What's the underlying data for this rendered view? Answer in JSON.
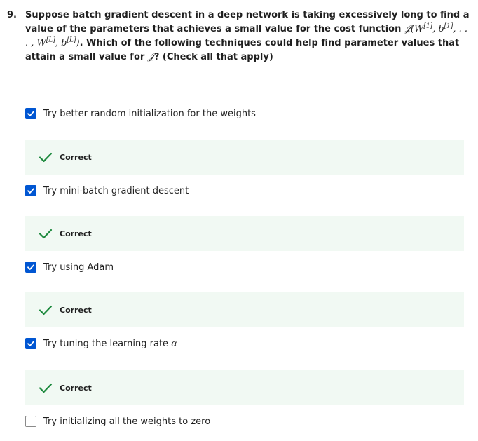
{
  "question": {
    "number": "9.",
    "text_part1": "Suppose batch gradient descent in a deep network is taking excessively long to find a value of the parameters that achieves a small value for the cost function ",
    "formula_start": "𝒥(W",
    "sup1": "[1]",
    "formula_b": ", b",
    "sup2": "[1]",
    "formula_mid": ", . . . , W",
    "sup3": "[L]",
    "formula_b2": ", b",
    "sup4": "[L]",
    "formula_end": ")",
    "text_part2": ". Which of the following techniques could help find parameter values that attain a small value for ",
    "cost_symbol": "𝒥",
    "text_part3": "? (Check all that apply)"
  },
  "options": [
    {
      "label": "Try better random initialization for the weights",
      "checked": true
    },
    {
      "label": "Try mini-batch gradient descent",
      "checked": true
    },
    {
      "label": "Try using Adam",
      "checked": true
    },
    {
      "label": "Try tuning the learning rate ",
      "symbol": "α",
      "checked": true
    },
    {
      "label": "Try initializing all the weights to zero",
      "checked": false
    }
  ],
  "feedback": [
    {
      "label": "Correct"
    },
    {
      "label": "Correct"
    },
    {
      "label": "Correct"
    },
    {
      "label": "Correct"
    }
  ],
  "colors": {
    "checkbox_checked": "#0056d2",
    "checkmark_correct": "#1e8a3e",
    "feedback_bg": "#f1f9f3"
  },
  "icons": {
    "checkbox_checked": "checkbox-checked-icon",
    "checkbox_unchecked": "checkbox-unchecked-icon",
    "correct": "checkmark-icon"
  }
}
